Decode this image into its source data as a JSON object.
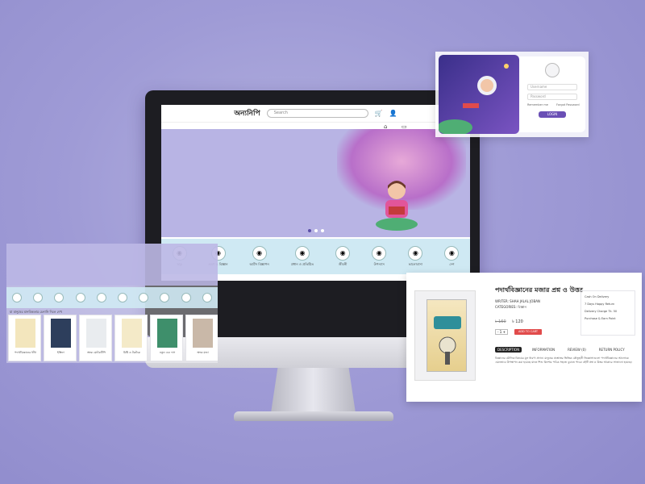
{
  "header": {
    "logo": "অন্যনিপি",
    "search_placeholder": "Search"
  },
  "categories": [
    {
      "label": "ঋতু"
    },
    {
      "label": "ভ্রমণ ও বিজ্ঞান"
    },
    {
      "label": "আর্টস বিজ্ঞাপন"
    },
    {
      "label": "প্রধান ও প্রতিষ্ঠিত"
    },
    {
      "label": "জীবনী"
    },
    {
      "label": "উপন্যাস"
    },
    {
      "label": "ভালোবাসা"
    },
    {
      "label": "দেশ"
    }
  ],
  "login": {
    "username_placeholder": "Username",
    "password_placeholder": "Password",
    "remember": "Remember me",
    "forgot": "Forgot Password",
    "button": "LOGIN"
  },
  "left_panel": {
    "section_title": "যা মানুষের মানবিকতার চেনানি দিলে দেখ",
    "books": [
      {
        "title": "পদার্থবিজ্ঞানের ধাঁধা"
      },
      {
        "title": "ইস্তিফা"
      },
      {
        "title": "অংক মোটকটিপি"
      },
      {
        "title": "মিষ্টি ও টকটকে"
      },
      {
        "title": "নতুন এক দাস"
      },
      {
        "title": "অংক মজা"
      }
    ]
  },
  "product": {
    "title": "পদার্থবিজ্ঞানের মজার প্রশ্ন ও উত্তর",
    "writer": "WRITER: SHAH JALAL JOBAN",
    "categories": "CATEGORIES: বিজ্ঞান",
    "old_price": "৳ 160",
    "price": "৳ 120",
    "qty": "- 1 +",
    "cart": "ADD TO CART",
    "side": [
      "Cash On Delivery",
      "7 Days Happy Return",
      "Delivery Charge Tk. 50",
      "Purchase & Earn Point"
    ],
    "tabs": [
      "DESCRIPTION",
      "INFORMATION",
      "REVIEW (0)",
      "RETURN POLICY"
    ],
    "description": "বিজ্ঞানের মৌলিক বিষয়ের মূল ধারণা প্রদান। মানুষের প্রশ্নোত্তর ভিত্তিক কৌতূহলী জিজ্ঞাসাগুলো পদার্থবিজ্ঞানের আলোকে এমনভাবে উপস্থাপন করা হয়েছে যাতে শিশু কিশোর পাঠক সহজে বুঝতে পারে। বইটি প্রশ্ন ও উত্তর আকারে সাজানো হয়েছে।"
  },
  "colors": {
    "accent": "#6a4fb5",
    "cart": "#e14b4b",
    "catbar": "#cfe9f3",
    "hero": "#b8b4e4"
  }
}
